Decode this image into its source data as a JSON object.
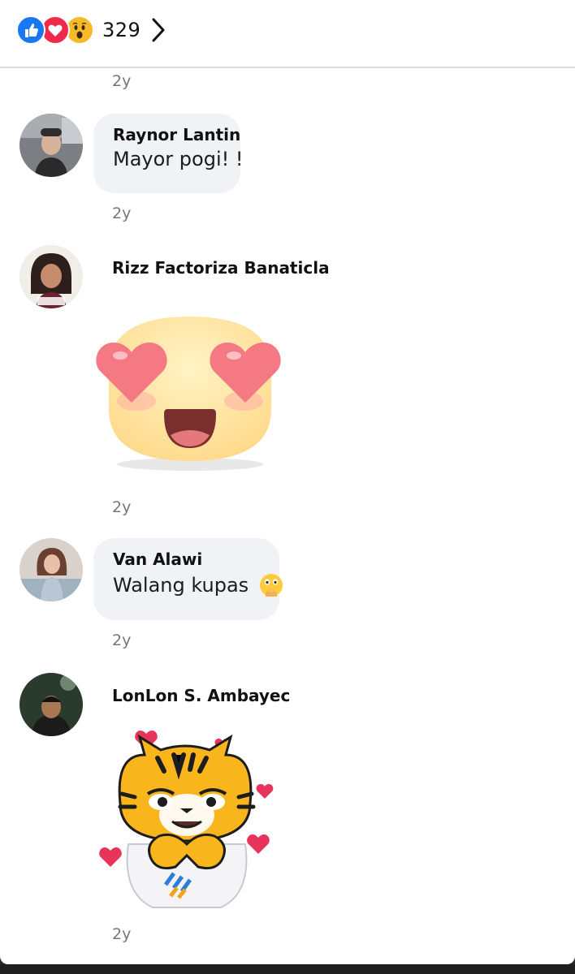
{
  "header": {
    "reactions": [
      "like-icon",
      "love-icon",
      "wow-icon"
    ],
    "count": "329"
  },
  "comments": [
    {
      "time": "2y"
    },
    {
      "name": "Raynor Lantin",
      "text": "Mayor pogi! !",
      "time": "2y"
    },
    {
      "name": "Rizz Factoriza Banaticla",
      "sticker": "heart-eyes-emoji-sticker",
      "time": "2y"
    },
    {
      "name": "Van Alawi",
      "text": "Walang kupas",
      "emoji": "face-with-open-eyes-and-hand-over-mouth-icon",
      "time": "2y"
    },
    {
      "name": "LonLon S. Ambayec",
      "sticker": "tiger-heart-hands-sticker",
      "time": "2y"
    }
  ],
  "colors": {
    "like": "#1877f2",
    "love": "#f0284a",
    "bubble": "#f0f2f5"
  }
}
